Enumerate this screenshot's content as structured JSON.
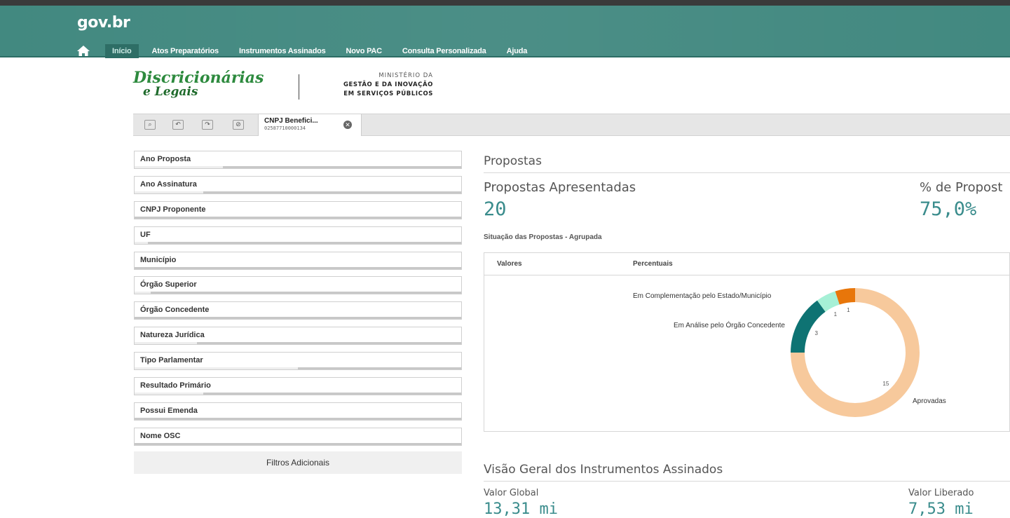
{
  "header": {
    "brand": "gov.br",
    "nav": [
      "Início",
      "Atos Preparatórios",
      "Instrumentos Assinados",
      "Novo PAC",
      "Consulta Personalizada",
      "Ajuda"
    ],
    "active_index": 0,
    "colors": {
      "header": "#3c857c",
      "active": "#2e6e66"
    }
  },
  "logo": {
    "line1": "Discricionárias",
    "line2": "e Legais",
    "ministry1": "MINISTÉRIO DA",
    "ministry2": "GESTÃO E DA INOVAÇÃO",
    "ministry3": "EM SERVIÇOS PÚBLICOS"
  },
  "toolbar": {
    "icons": [
      "search-select-icon",
      "select-back-icon",
      "select-forward-icon",
      "clear-selection-icon"
    ],
    "chip": {
      "title": "CNPJ Benefici...",
      "value": "02587710000134"
    }
  },
  "filters": [
    {
      "label": "Ano Proposta",
      "fill": 0.27
    },
    {
      "label": "Ano Assinatura",
      "fill": 0.21
    },
    {
      "label": "CNPJ Proponente",
      "fill": 0.0
    },
    {
      "label": "UF",
      "fill": 0.04
    },
    {
      "label": "Município",
      "fill": 0.0
    },
    {
      "label": "Órgão Superior",
      "fill": 0.05
    },
    {
      "label": "Órgão Concedente",
      "fill": 0.0
    },
    {
      "label": "Natureza Jurídica",
      "fill": 0.19
    },
    {
      "label": "Tipo Parlamentar",
      "fill": 0.5
    },
    {
      "label": "Resultado Primário",
      "fill": 0.21
    },
    {
      "label": "Possui Emenda",
      "fill": 0.0
    },
    {
      "label": "Nome OSC",
      "fill": 0.0
    }
  ],
  "more_filters": "Filtros Adicionais",
  "propostas": {
    "title": "Propostas",
    "kpi1_label": "Propostas Apresentadas",
    "kpi1_value": "20",
    "kpi2_label": "% de Propost",
    "kpi2_value": "75,0%",
    "chart_title": "Situação das Propostas - Agrupada",
    "tabs": [
      "Valores",
      "Percentuais"
    ]
  },
  "chart_data": {
    "type": "pie",
    "donut": true,
    "title": "Situação das Propostas - Agrupada",
    "categories": [
      "Aprovadas",
      "Em Análise pelo Órgão Concedente",
      "",
      "Em Complementação pelo Estado/Município"
    ],
    "values": [
      15,
      3,
      1,
      1
    ],
    "colors": [
      "#f7c99c",
      "#0e7373",
      "#a6f0d6",
      "#e8760a"
    ]
  },
  "visao": {
    "title": "Visão Geral dos Instrumentos Assinados",
    "label1": "Valor Global",
    "value1": "13,31 mi",
    "label2": "Valor Liberado",
    "value2": "7,53 mi"
  }
}
